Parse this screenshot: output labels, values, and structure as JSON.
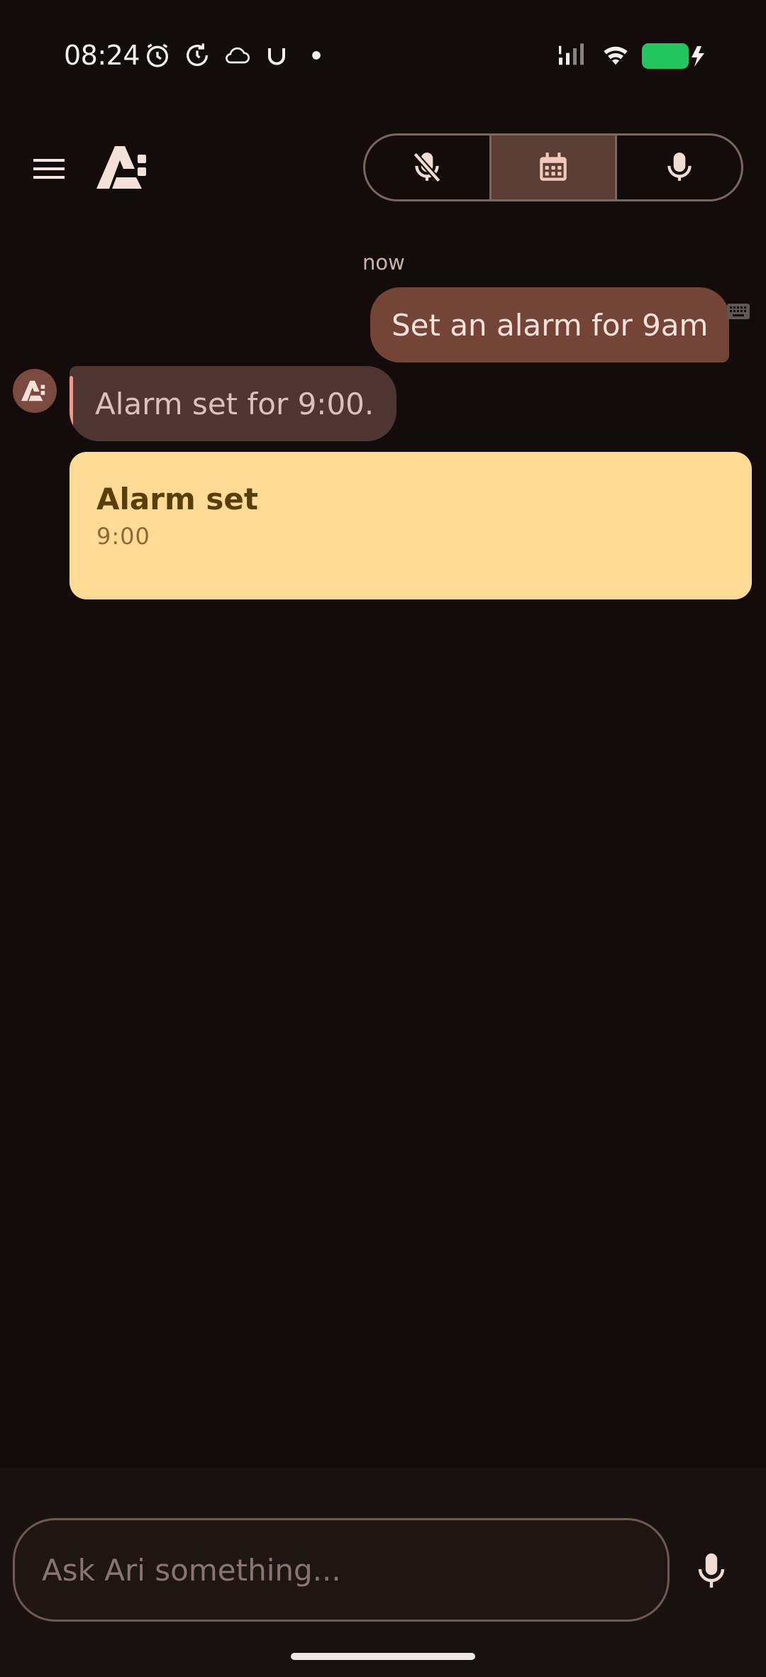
{
  "status_bar": {
    "time": "08:24",
    "icons": [
      "alarm-icon",
      "sync-icon",
      "cloud-icon",
      "u-icon",
      "dot-icon",
      "signal-icon",
      "wifi-icon",
      "battery-charging-icon"
    ],
    "battery_color": "#22c55e"
  },
  "toolbar": {
    "segments": [
      {
        "name": "mic-off",
        "icon": "mic-off-icon",
        "active": false
      },
      {
        "name": "calendar",
        "icon": "calendar-icon",
        "active": true
      },
      {
        "name": "mic",
        "icon": "mic-icon",
        "active": false
      }
    ]
  },
  "chat": {
    "timestamp": "now",
    "user_message": "Set an alarm for 9am",
    "bot_message": "Alarm set for 9:00.",
    "card": {
      "title": "Alarm set",
      "subtitle": "9:00"
    }
  },
  "input": {
    "placeholder": "Ask Ari something..."
  },
  "colors": {
    "background": "#130c0b",
    "user_bubble": "#744537",
    "bot_bubble": "#4f3530",
    "card": "#ffdb95",
    "accent": "#ee9a92"
  }
}
